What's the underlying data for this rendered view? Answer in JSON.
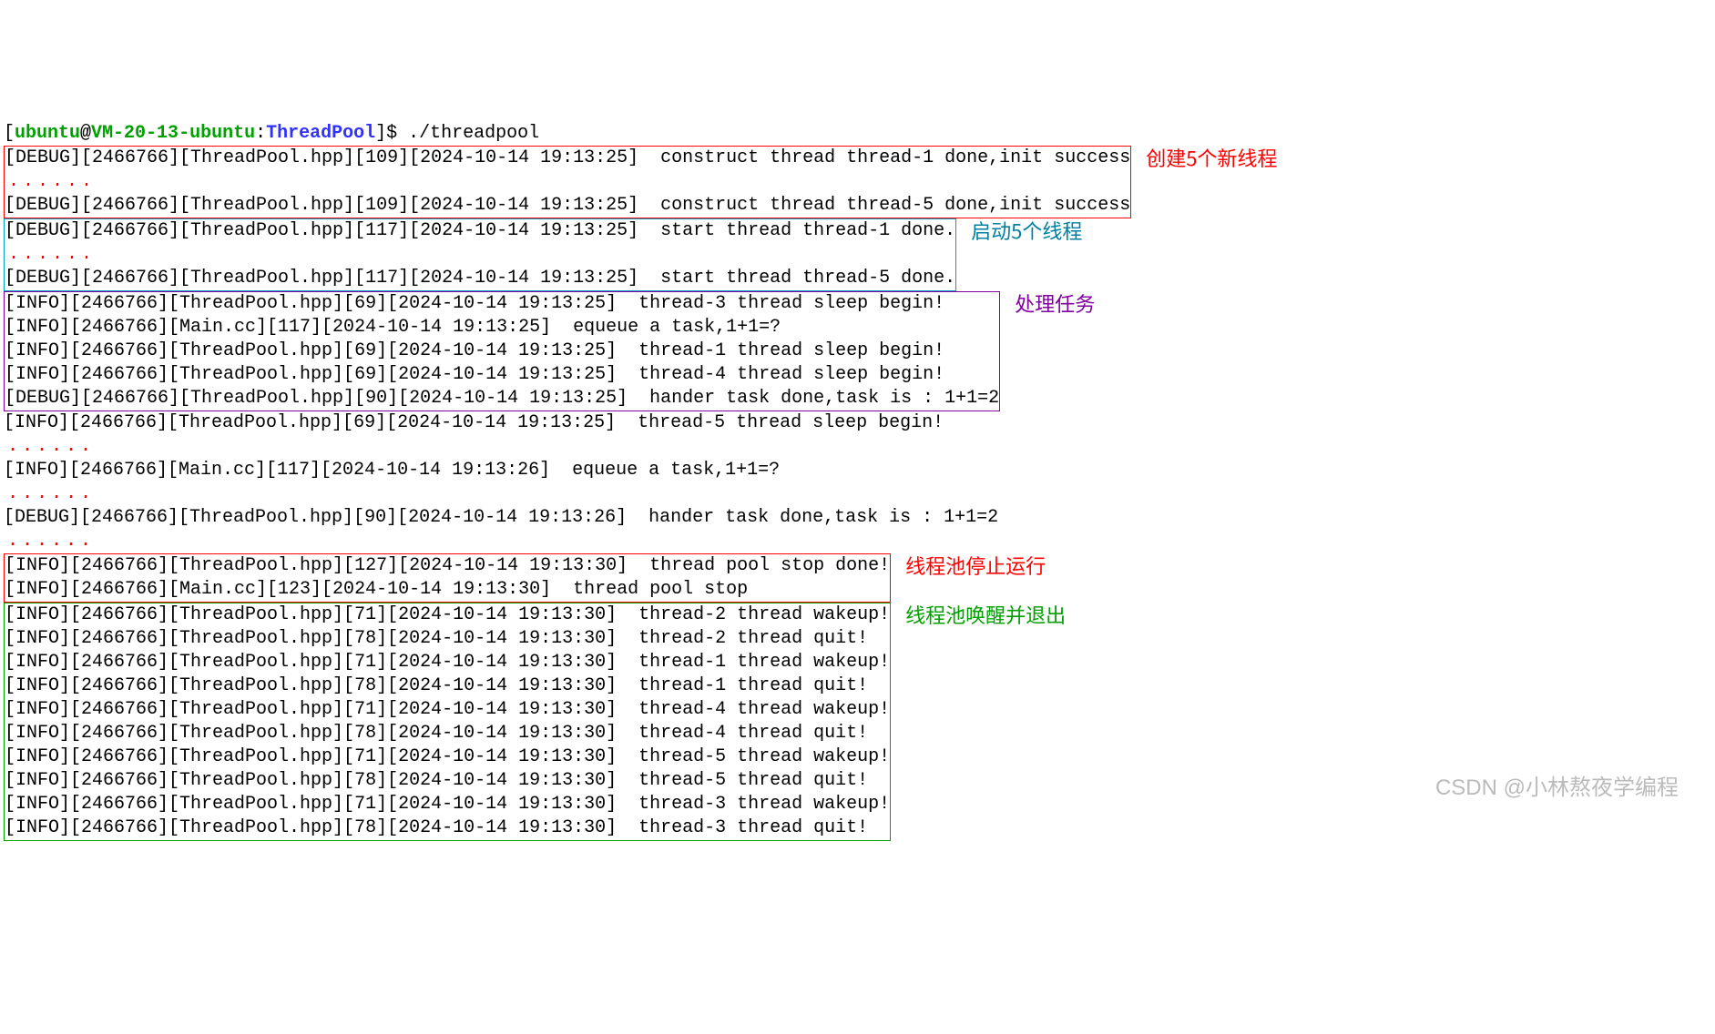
{
  "prompt": {
    "open": "[",
    "user": "ubuntu",
    "at": "@",
    "host": "VM-20-13-ubuntu",
    "colon": ":",
    "path": "ThreadPool",
    "close": "]$ ",
    "command": "./threadpool"
  },
  "dots": "......",
  "blocks": {
    "create": {
      "line1": "[DEBUG][2466766][ThreadPool.hpp][109][2024-10-14 19:13:25]  construct thread thread-1 done,init success",
      "line2": "[DEBUG][2466766][ThreadPool.hpp][109][2024-10-14 19:13:25]  construct thread thread-5 done,init success",
      "annot": "创建5个新线程"
    },
    "start": {
      "line1": "[DEBUG][2466766][ThreadPool.hpp][117][2024-10-14 19:13:25]  start thread thread-1 done.",
      "line2": "[DEBUG][2466766][ThreadPool.hpp][117][2024-10-14 19:13:25]  start thread thread-5 done.",
      "annot": "启动5个线程"
    },
    "task": {
      "l1": "[INFO][2466766][ThreadPool.hpp][69][2024-10-14 19:13:25]  thread-3 thread sleep begin!",
      "l2": "[INFO][2466766][Main.cc][117][2024-10-14 19:13:25]  equeue a task,1+1=?",
      "l3": "[INFO][2466766][ThreadPool.hpp][69][2024-10-14 19:13:25]  thread-1 thread sleep begin!",
      "l4": "[INFO][2466766][ThreadPool.hpp][69][2024-10-14 19:13:25]  thread-4 thread sleep begin!",
      "l5": "[DEBUG][2466766][ThreadPool.hpp][90][2024-10-14 19:13:25]  hander task done,task is : 1+1=2",
      "annot": "处理任务"
    },
    "mid": {
      "l1": "[INFO][2466766][ThreadPool.hpp][69][2024-10-14 19:13:25]  thread-5 thread sleep begin!",
      "l2": "[INFO][2466766][Main.cc][117][2024-10-14 19:13:26]  equeue a task,1+1=?",
      "l3": "[DEBUG][2466766][ThreadPool.hpp][90][2024-10-14 19:13:26]  hander task done,task is : 1+1=2"
    },
    "stop": {
      "l1": "[INFO][2466766][ThreadPool.hpp][127][2024-10-14 19:13:30]  thread pool stop done!",
      "l2": "[INFO][2466766][Main.cc][123][2024-10-14 19:13:30]  thread pool stop",
      "annot": "线程池停止运行"
    },
    "quit": {
      "l1": "[INFO][2466766][ThreadPool.hpp][71][2024-10-14 19:13:30]  thread-2 thread wakeup!",
      "l2": "[INFO][2466766][ThreadPool.hpp][78][2024-10-14 19:13:30]  thread-2 thread quit!",
      "l3": "[INFO][2466766][ThreadPool.hpp][71][2024-10-14 19:13:30]  thread-1 thread wakeup!",
      "l4": "[INFO][2466766][ThreadPool.hpp][78][2024-10-14 19:13:30]  thread-1 thread quit!",
      "l5": "[INFO][2466766][ThreadPool.hpp][71][2024-10-14 19:13:30]  thread-4 thread wakeup!",
      "l6": "[INFO][2466766][ThreadPool.hpp][78][2024-10-14 19:13:30]  thread-4 thread quit!",
      "l7": "[INFO][2466766][ThreadPool.hpp][71][2024-10-14 19:13:30]  thread-5 thread wakeup!",
      "l8": "[INFO][2466766][ThreadPool.hpp][78][2024-10-14 19:13:30]  thread-5 thread quit!",
      "l9": "[INFO][2466766][ThreadPool.hpp][71][2024-10-14 19:13:30]  thread-3 thread wakeup!",
      "l10": "[INFO][2466766][ThreadPool.hpp][78][2024-10-14 19:13:30]  thread-3 thread quit!",
      "annot": "线程池唤醒并退出"
    }
  },
  "watermark": "CSDN @小林熬夜学编程"
}
